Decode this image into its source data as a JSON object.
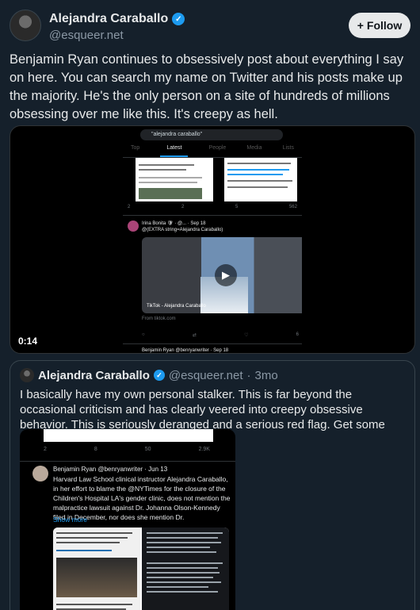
{
  "author": {
    "display_name": "Alejandra Caraballo",
    "handle": "@esqueer.net",
    "verified_glyph": "✓"
  },
  "follow_button": {
    "icon": "plus-icon",
    "glyph": "+",
    "label": "Follow"
  },
  "post": {
    "text": "Benjamin Ryan continues to obsessively post about everything I say on here. You can search my name on Twitter and his posts make up the majority. He's the only person on a site of hundreds of millions obsessing over me like this. It's creepy as hell."
  },
  "video": {
    "timestamp": "0:14",
    "phone": {
      "search_query": "\"alejandra caraballo\"",
      "tabs": [
        "Top",
        "Latest",
        "People",
        "Media",
        "Lists"
      ],
      "active_tab": "Latest",
      "actions_1": [
        "2",
        "2",
        "5",
        "562"
      ],
      "post_user": "Irina Bonita 🛡 · @... · Sep 18",
      "post_text": "@(EXTRA string=Alejandra Caraballo)",
      "video_label": "TikTok - Alejandra Caraballo",
      "from": "From tiktok.com",
      "actions_2": [
        "",
        "",
        "",
        "6"
      ],
      "next_user": "Benjamin Ryan @benryanwriter · Sep 18"
    }
  },
  "quote": {
    "display_name": "Alejandra Caraballo",
    "handle": "@esqueer.net",
    "dot": "·",
    "time": "3mo",
    "verified_glyph": "✓",
    "text": "I basically have my own personal stalker. This is far beyond the occasional criticism and has clearly veered into creepy obsessive behavior. This is seriously deranged and a serious red flag. Get some help Ben.",
    "screenshot": {
      "actions": [
        "2",
        "8",
        "50",
        "2.9K"
      ],
      "user": "Benjamin Ryan @benryanwriter · Jun 13",
      "body": "Harvard Law School clinical instructor Alejandra Caraballo, in her effort to blame the @NYTimes for the closure of the Children's Hospital LA's gender clinic, does not mention the malpractice lawsuit against Dr. Johanna Olson-Kennedy filed in December, nor does she mention Dr.",
      "show_more": "Show more"
    }
  }
}
